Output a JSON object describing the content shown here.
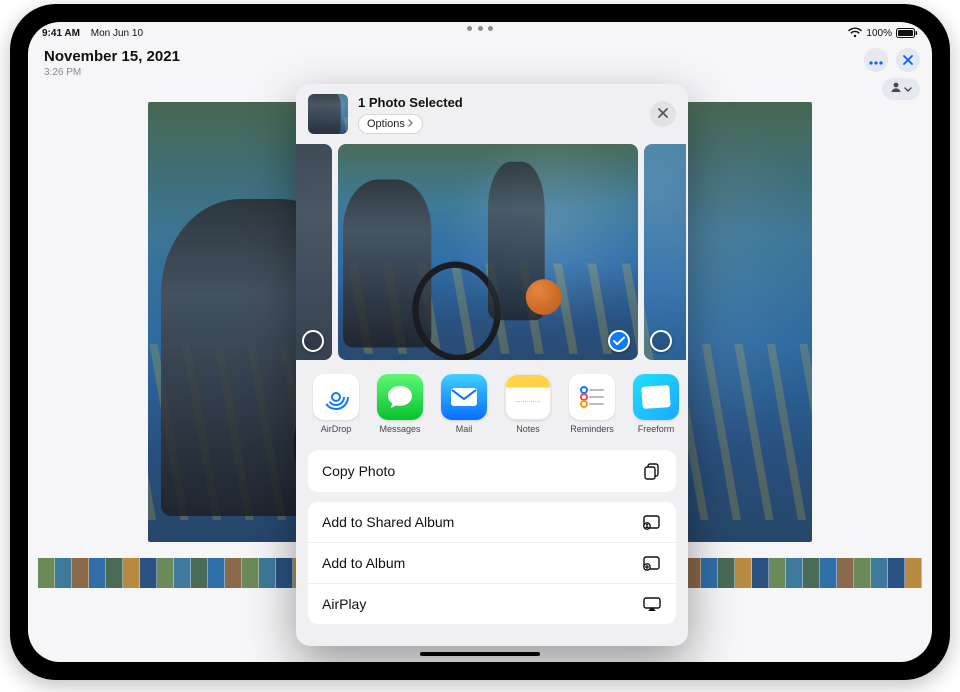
{
  "status_bar": {
    "time": "9:41 AM",
    "date": "Mon Jun 10",
    "battery_percent": "100%",
    "wifi_icon": "wifi",
    "battery_icon": "battery-full"
  },
  "photos_app": {
    "date_title": "November 15, 2021",
    "time_subtitle": "3:26 PM",
    "more_button_icon": "ellipsis",
    "close_button_icon": "xmark",
    "people_button_icon": "person"
  },
  "share_sheet": {
    "title": "1 Photo Selected",
    "options_label": "Options",
    "close_icon": "xmark",
    "thumbnails": [
      {
        "selected": false
      },
      {
        "selected": true
      },
      {
        "selected": false
      }
    ],
    "apps": [
      {
        "name": "AirDrop",
        "key": "airdrop"
      },
      {
        "name": "Messages",
        "key": "messages"
      },
      {
        "name": "Mail",
        "key": "mail"
      },
      {
        "name": "Notes",
        "key": "notes"
      },
      {
        "name": "Reminders",
        "key": "reminders"
      },
      {
        "name": "Freeform",
        "key": "freeform"
      }
    ],
    "actions_group1": [
      {
        "label": "Copy Photo",
        "icon": "copy-icon"
      }
    ],
    "actions_group2": [
      {
        "label": "Add to Shared Album",
        "icon": "shared-album-icon"
      },
      {
        "label": "Add to Album",
        "icon": "album-icon"
      },
      {
        "label": "AirPlay",
        "icon": "airplay-icon"
      }
    ]
  }
}
